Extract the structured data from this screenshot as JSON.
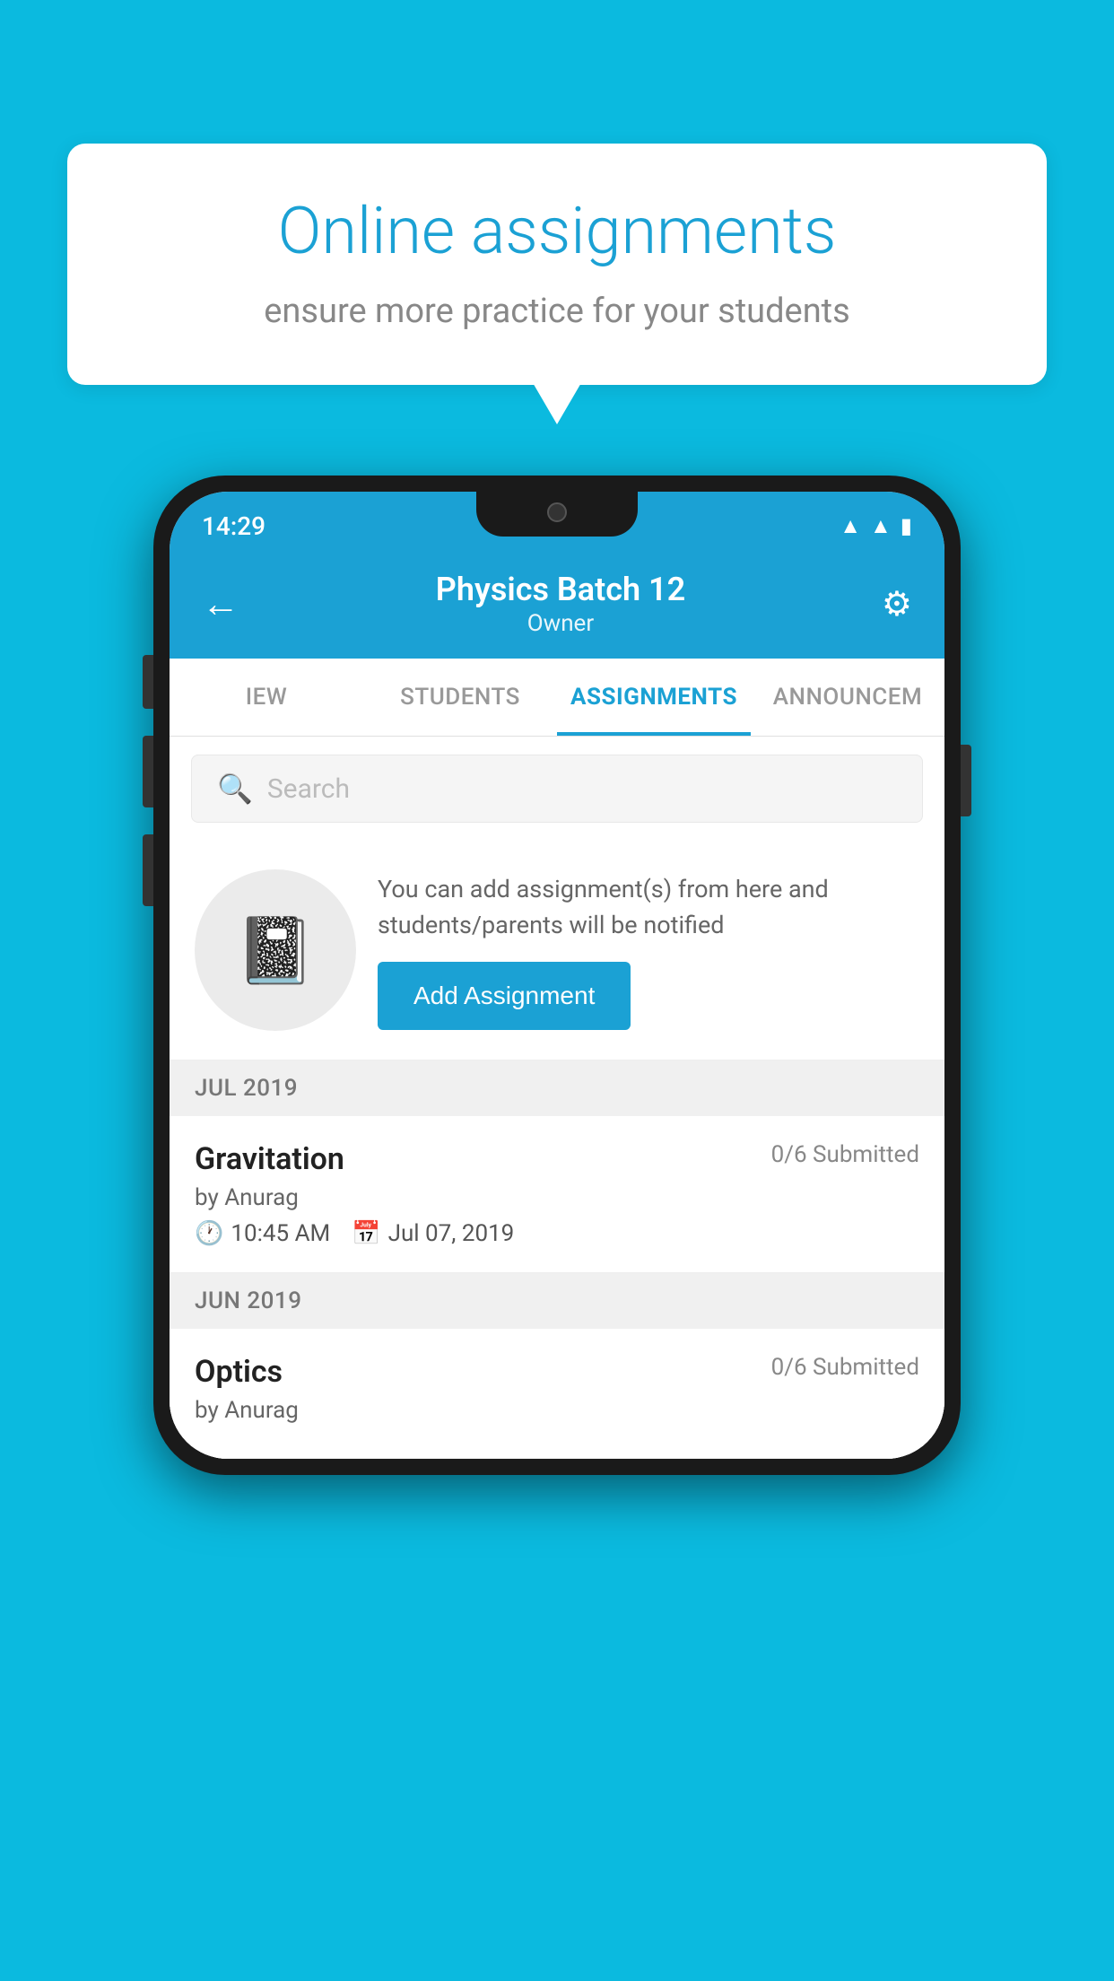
{
  "background_color": "#0BBADF",
  "speech_bubble": {
    "title": "Online assignments",
    "subtitle": "ensure more practice for your students"
  },
  "phone": {
    "status_bar": {
      "time": "14:29",
      "icons": [
        "wifi",
        "signal",
        "battery"
      ]
    },
    "header": {
      "title": "Physics Batch 12",
      "subtitle": "Owner",
      "back_label": "←",
      "settings_label": "⚙"
    },
    "tabs": [
      {
        "label": "IEW",
        "active": false
      },
      {
        "label": "STUDENTS",
        "active": false
      },
      {
        "label": "ASSIGNMENTS",
        "active": true
      },
      {
        "label": "ANNOUNCEM",
        "active": false
      }
    ],
    "search": {
      "placeholder": "Search"
    },
    "promo": {
      "description": "You can add assignment(s) from here and students/parents will be notified",
      "button_label": "Add Assignment"
    },
    "sections": [
      {
        "month_label": "JUL 2019",
        "assignments": [
          {
            "name": "Gravitation",
            "submitted": "0/6 Submitted",
            "by": "by Anurag",
            "time": "10:45 AM",
            "date": "Jul 07, 2019"
          }
        ]
      },
      {
        "month_label": "JUN 2019",
        "assignments": [
          {
            "name": "Optics",
            "submitted": "0/6 Submitted",
            "by": "by Anurag",
            "time": "",
            "date": ""
          }
        ]
      }
    ]
  }
}
